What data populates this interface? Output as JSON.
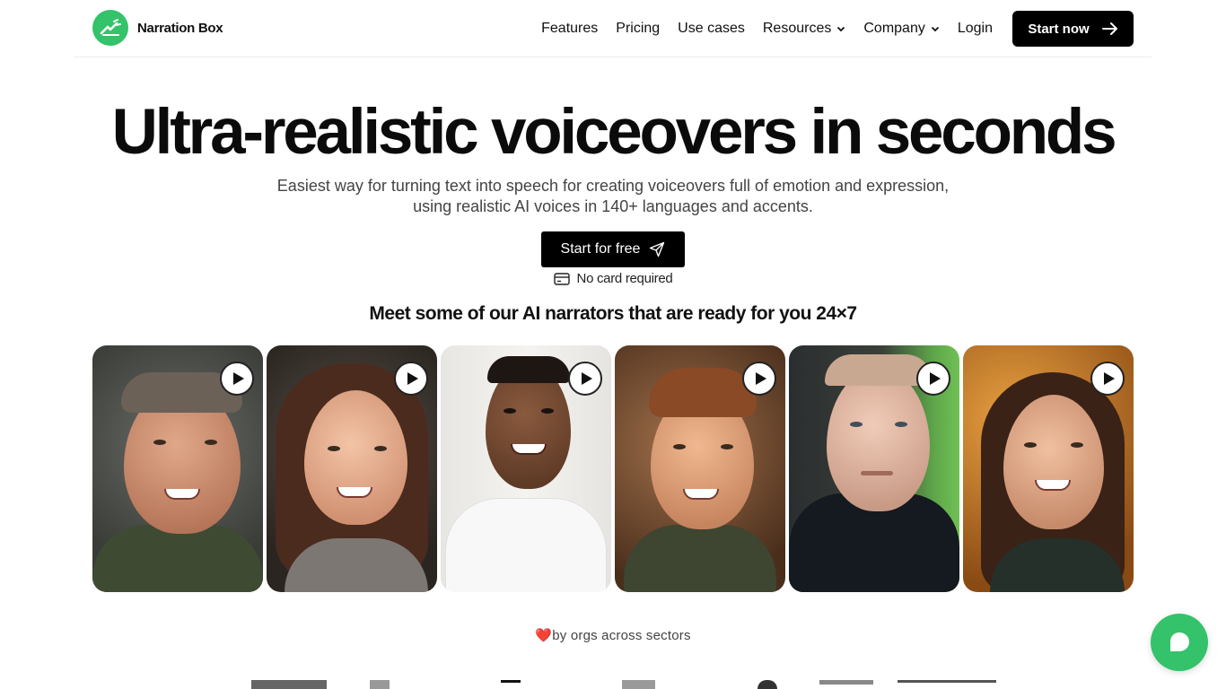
{
  "brand": {
    "name": "Narration Box",
    "accent": "#34c26a"
  },
  "nav": {
    "items": [
      {
        "label": "Features",
        "dropdown": false
      },
      {
        "label": "Pricing",
        "dropdown": false
      },
      {
        "label": "Use cases",
        "dropdown": false
      },
      {
        "label": "Resources",
        "dropdown": true
      },
      {
        "label": "Company",
        "dropdown": true
      },
      {
        "label": "Login",
        "dropdown": false
      }
    ],
    "cta_label": "Start now"
  },
  "hero": {
    "title": "Ultra-realistic voiceovers in seconds",
    "subtitle_line1": "Easiest way for turning text into speech for creating voiceovers full of emotion and expression,",
    "subtitle_line2": "using realistic AI voices in 140+ languages and accents.",
    "cta_label": "Start for free",
    "no_card": "No card required"
  },
  "narrators": {
    "heading": "Meet some of our AI narrators that are ready for you 24×7"
  },
  "social_proof": {
    "heart": "❤️",
    "text": "by orgs across sectors"
  }
}
